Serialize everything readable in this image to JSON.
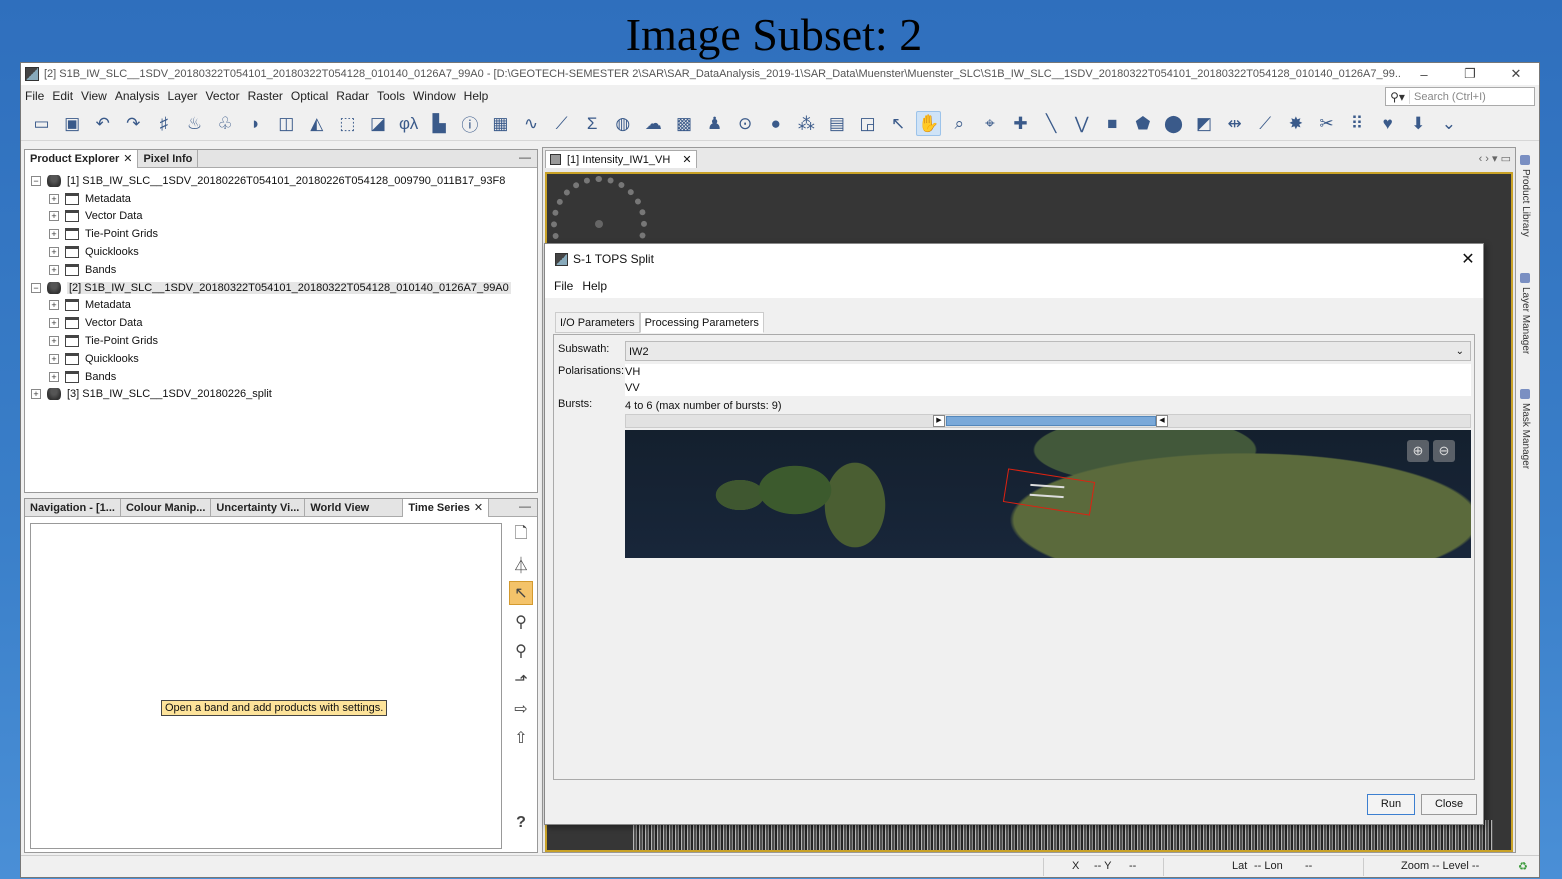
{
  "slide_title": "Image Subset: 2",
  "window": {
    "title": "[2] S1B_IW_SLC__1SDV_20180322T054101_20180322T054128_010140_0126A7_99A0 - [D:\\GEOTECH-SEMESTER 2\\SAR\\SAR_DataAnalysis_2019-1\\SAR_Data\\Muenster\\Muenster_SLC\\S1B_IW_SLC__1SDV_20180322T054101_20180322T054128_010140_0126A7_99..."
  },
  "menu": [
    "File",
    "Edit",
    "View",
    "Analysis",
    "Layer",
    "Vector",
    "Raster",
    "Optical",
    "Radar",
    "Tools",
    "Window",
    "Help"
  ],
  "search": {
    "placeholder": "Search (Ctrl+I)"
  },
  "left_panel": {
    "tabs": [
      "Product Explorer",
      "Pixel Info"
    ],
    "tree": [
      {
        "label": "[1] S1B_IW_SLC__1SDV_20180226T054101_20180226T054128_009790_011B17_93F8",
        "level": 0,
        "exp": "−",
        "icon": "product",
        "sel": false
      },
      {
        "label": "Metadata",
        "level": 1,
        "exp": "+",
        "icon": "folder"
      },
      {
        "label": "Vector Data",
        "level": 1,
        "exp": "+",
        "icon": "folder"
      },
      {
        "label": "Tie-Point Grids",
        "level": 1,
        "exp": "+",
        "icon": "folder"
      },
      {
        "label": "Quicklooks",
        "level": 1,
        "exp": "+",
        "icon": "folder"
      },
      {
        "label": "Bands",
        "level": 1,
        "exp": "+",
        "icon": "folder"
      },
      {
        "label": "[2] S1B_IW_SLC__1SDV_20180322T054101_20180322T054128_010140_0126A7_99A0",
        "level": 0,
        "exp": "−",
        "icon": "product",
        "sel": true
      },
      {
        "label": "Metadata",
        "level": 1,
        "exp": "+",
        "icon": "folder"
      },
      {
        "label": "Vector Data",
        "level": 1,
        "exp": "+",
        "icon": "folder"
      },
      {
        "label": "Tie-Point Grids",
        "level": 1,
        "exp": "+",
        "icon": "folder"
      },
      {
        "label": "Quicklooks",
        "level": 1,
        "exp": "+",
        "icon": "folder"
      },
      {
        "label": "Bands",
        "level": 1,
        "exp": "+",
        "icon": "folder"
      },
      {
        "label": "[3] S1B_IW_SLC__1SDV_20180226_split",
        "level": 0,
        "exp": "+",
        "icon": "product"
      }
    ]
  },
  "bottom_panel": {
    "tabs": [
      "Navigation - [1...",
      "Colour Manip...",
      "Uncertainty Vi...",
      "World View",
      "Time Series"
    ],
    "tooltip": "Open a band and add products with settings.",
    "help_icon": "?"
  },
  "doc_tab": {
    "label": "[1] Intensity_IW1_VH"
  },
  "side_strip": [
    "Product Library",
    "Layer Manager",
    "Mask Manager"
  ],
  "dialog": {
    "title": "S-1 TOPS Split",
    "menu": [
      "File",
      "Help"
    ],
    "tabs": [
      "I/O Parameters",
      "Processing Parameters"
    ],
    "subswath_label": "Subswath:",
    "subswath_value": "IW2",
    "polarisations_label": "Polarisations:",
    "polarisations": [
      "VH",
      "VV"
    ],
    "bursts_label": "Bursts:",
    "bursts_text": "4 to 6 (max number of bursts: 9)",
    "run_label": "Run",
    "close_label": "Close"
  },
  "status": {
    "x": "X",
    "x_val": "-- Y",
    "y_val": "--",
    "lat": "Lat",
    "lat_val": "-- Lon",
    "lon_val": "--",
    "zoom": "Zoom -- Level --"
  }
}
